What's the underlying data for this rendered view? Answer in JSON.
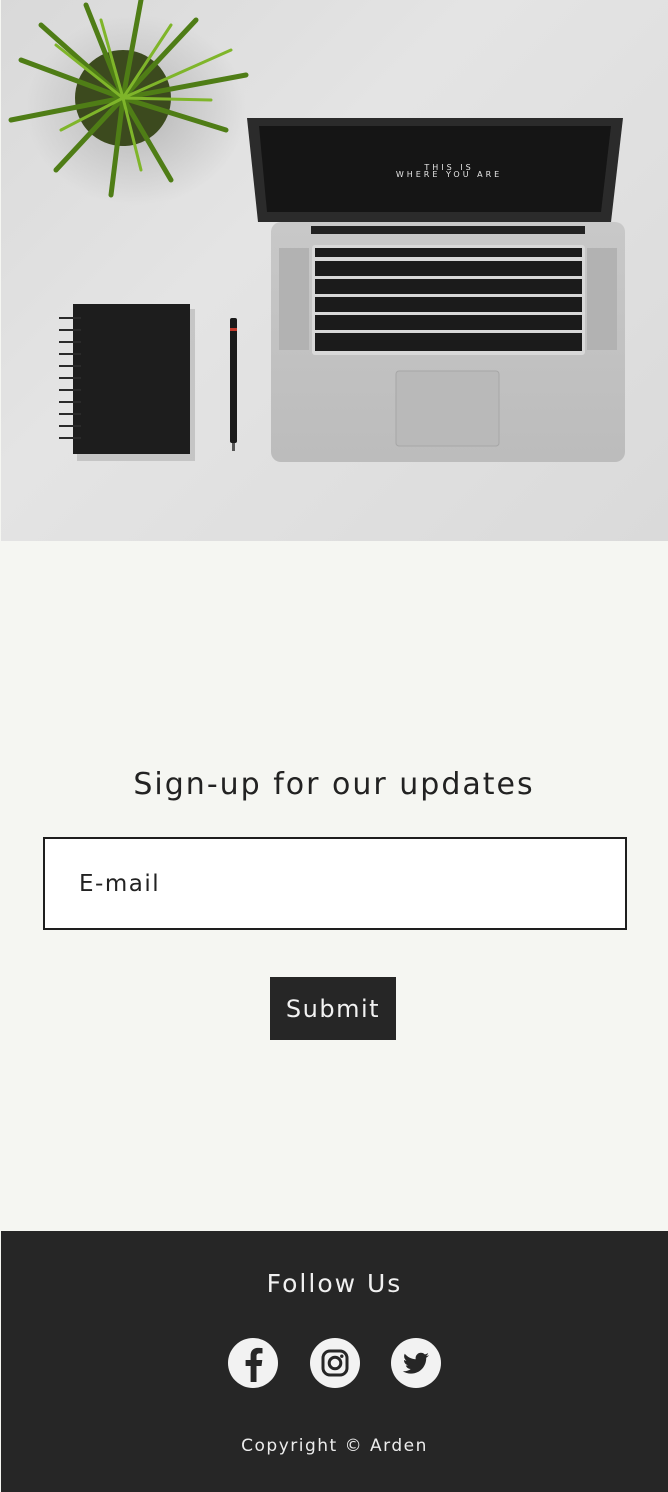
{
  "hero": {
    "laptop_screen_line1": "THIS IS",
    "laptop_screen_line2": "WHERE YOU ARE"
  },
  "signup": {
    "title": "Sign-up for our updates",
    "email_placeholder": "E-mail",
    "email_value": "",
    "submit_label": "Submit"
  },
  "footer": {
    "follow_title": "Follow Us",
    "social_links": [
      "facebook-icon",
      "instagram-icon",
      "twitter-icon"
    ],
    "copyright": "Copyright © Arden"
  },
  "colors": {
    "signup_background": "#f5f6f2",
    "footer_background": "#262626",
    "button_background": "#262626",
    "icon_circle": "#f2f2f2"
  }
}
